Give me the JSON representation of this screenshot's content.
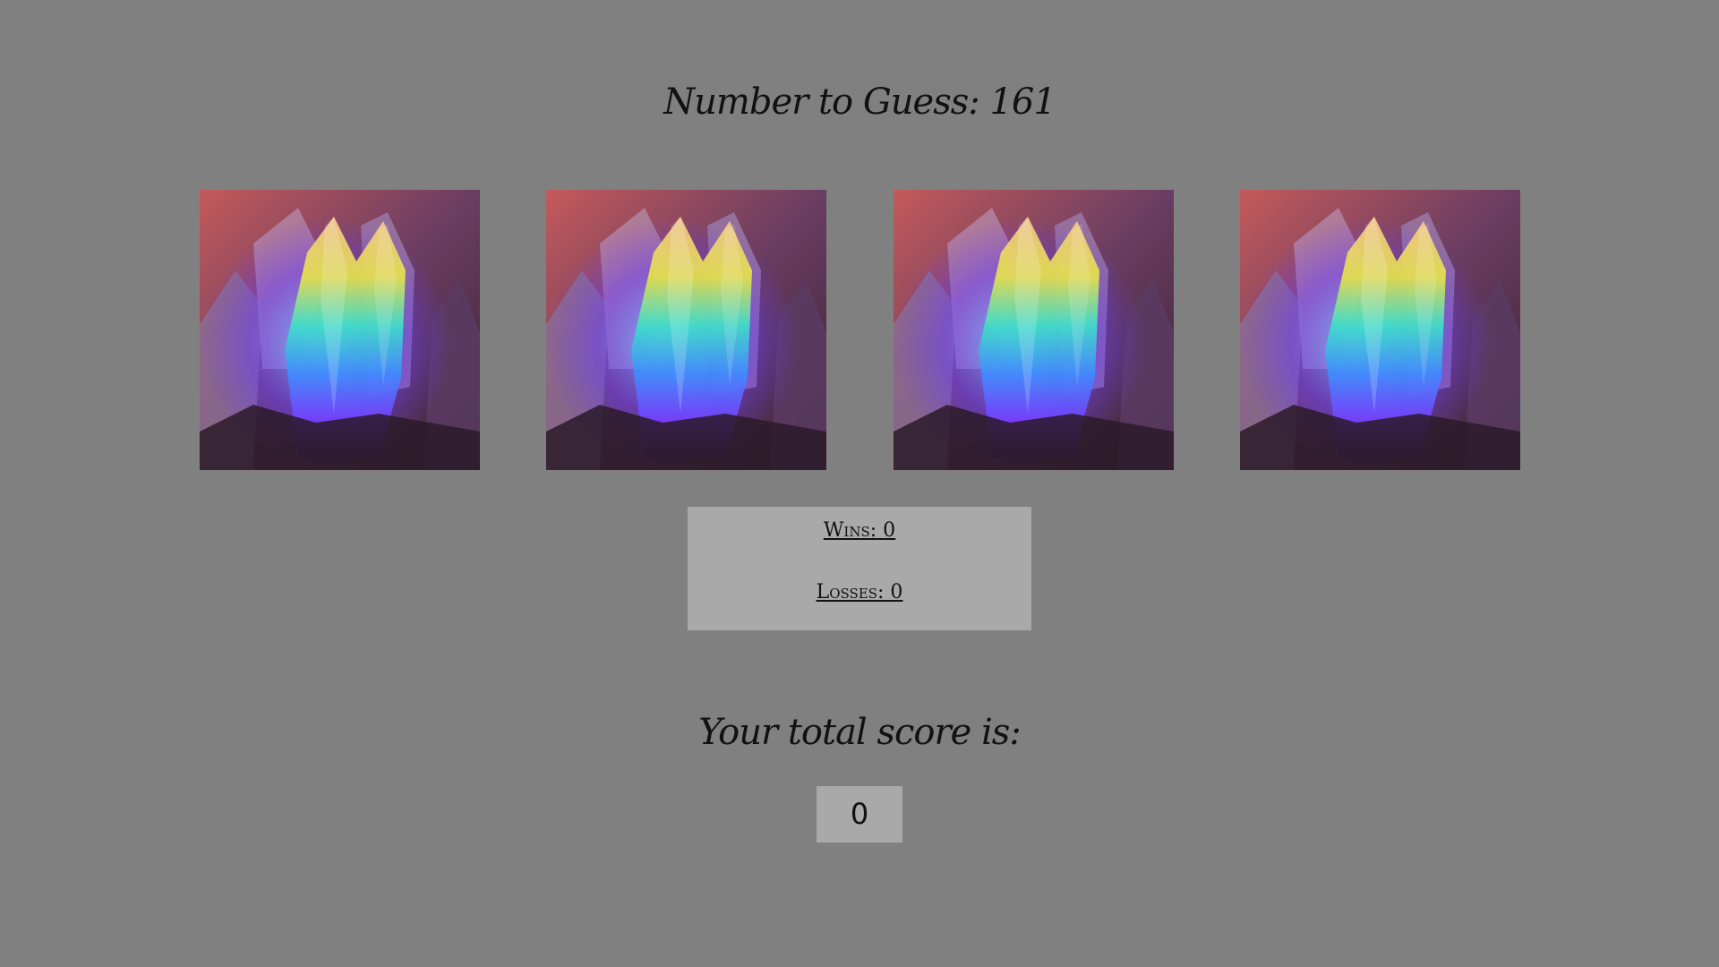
{
  "game": {
    "target_label": "Number to Guess:",
    "target_value": "161",
    "crystals": [
      {
        "name": "crystal-1"
      },
      {
        "name": "crystal-2"
      },
      {
        "name": "crystal-3"
      },
      {
        "name": "crystal-4"
      }
    ],
    "wins_label": "Wins:",
    "wins_value": "0",
    "losses_label": "Losses:",
    "losses_value": "0",
    "total_label": "Your total score is:",
    "total_value": "0"
  },
  "colors": {
    "background": "#808080",
    "panel": "#a9a9a9",
    "text": "#111111"
  }
}
